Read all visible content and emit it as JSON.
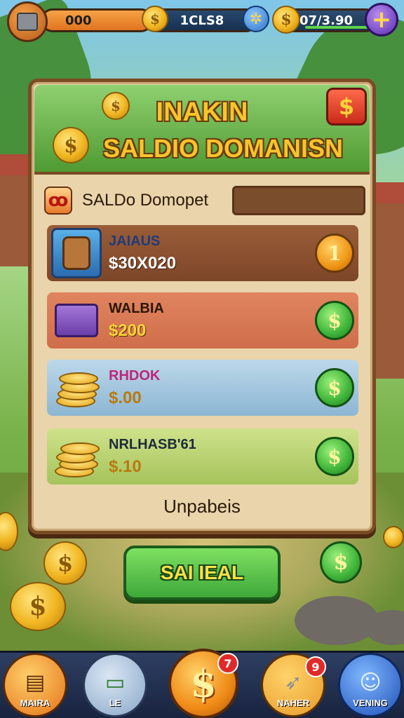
{
  "topbar": {
    "currency_1": "000",
    "currency_2": "1CLS8",
    "currency_3": "07/3.90",
    "plus_label": "+"
  },
  "panel": {
    "title_line_1": "INAKIN",
    "title_line_2": "SALDIO DOMANISN",
    "corner_badge": "$",
    "sub_icon": "ꝏ",
    "sub_label": "SALDo Domopet",
    "items": [
      {
        "name": "JAIAUS",
        "price": "$30X020",
        "button": "1"
      },
      {
        "name": "WALBIA",
        "price": "$200",
        "button": "$"
      },
      {
        "name": "RHDOK",
        "price": "$.00",
        "button": "$"
      },
      {
        "name": "NRLHASB'61",
        "price": "$.10",
        "button": "$"
      }
    ],
    "footer_text": "Unpabeis"
  },
  "action_button": "SAI IEAL",
  "side_button": "$",
  "coin_glyph": "$",
  "bottom_nav": {
    "items": [
      {
        "label": "MAIRA",
        "icon": "map-icon"
      },
      {
        "label": "LE",
        "icon": "cash-icon"
      },
      {
        "label": "",
        "icon": "dollar-coin-icon",
        "badge": "7"
      },
      {
        "label": "NAHER",
        "icon": "rocket-icon",
        "badge": "9"
      },
      {
        "label": "VENING",
        "icon": "users-icon"
      }
    ]
  },
  "colors": {
    "panel_bg": "#e9d4ab",
    "panel_border": "#7a4b24",
    "title_gold": "#f7c52c",
    "accent_green": "#3ea83a",
    "nav_bg": "#18233e"
  }
}
